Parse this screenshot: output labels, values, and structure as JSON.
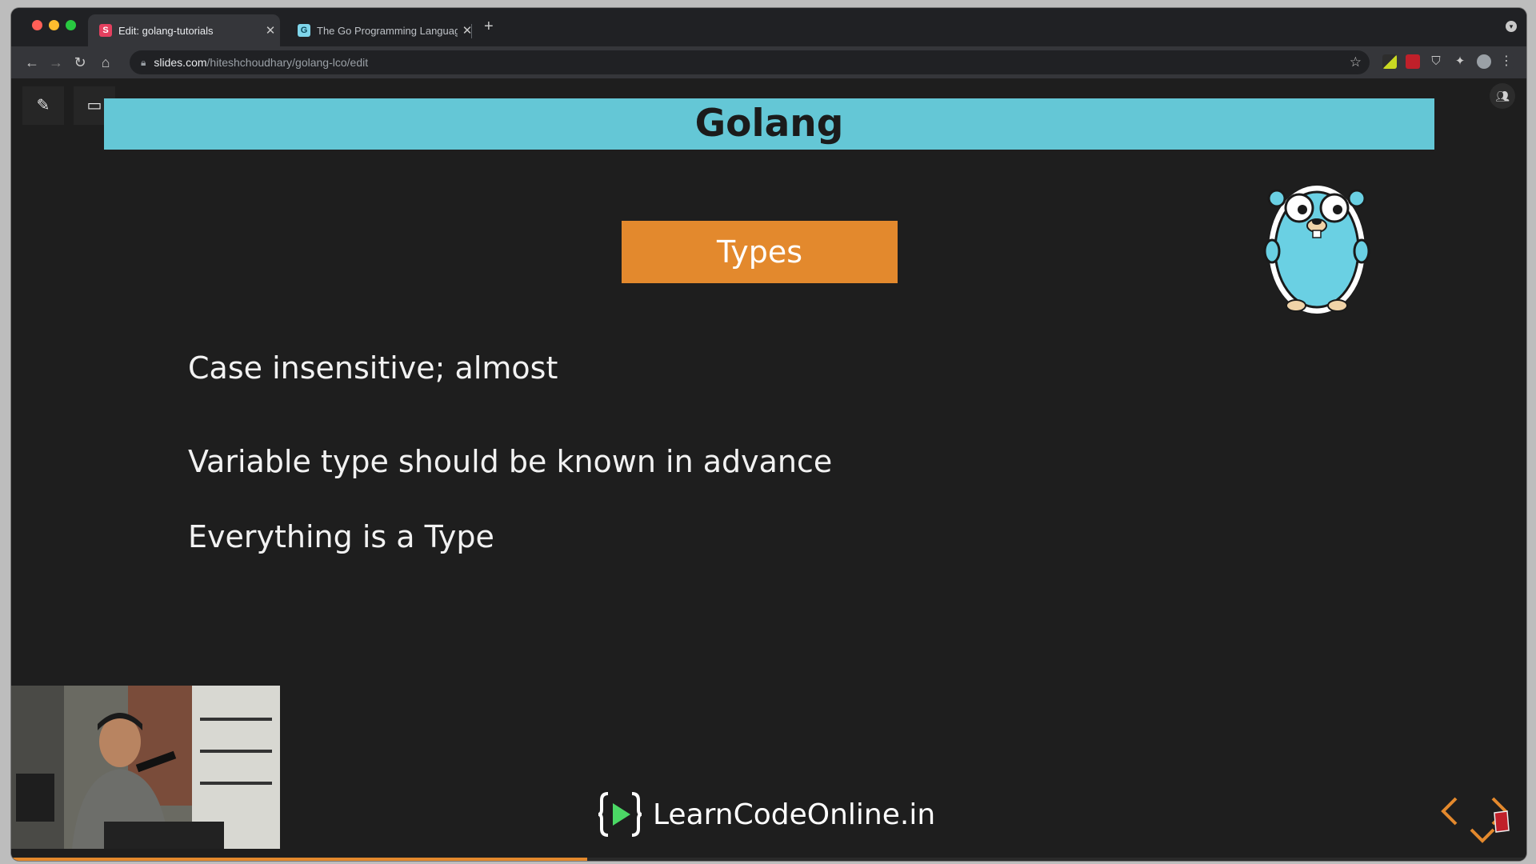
{
  "browser": {
    "tabs": [
      {
        "title": "Edit: golang-tutorials",
        "favicon_icon": "slides-icon",
        "active": true
      },
      {
        "title": "The Go Programming Languag",
        "favicon_icon": "go-icon",
        "active": false
      }
    ],
    "new_tab_label": "+",
    "url_host": "slides.com",
    "url_path": "/hiteshchoudhary/golang-lco/edit"
  },
  "editor": {
    "tools": [
      "pen-icon",
      "present-icon"
    ],
    "collaborators_icon": "people-icon"
  },
  "slide": {
    "title": "Golang",
    "section": "Types",
    "bullets": [
      "Case insensitive; almost",
      "Variable type should be known in advance",
      "Everything is a Type"
    ],
    "logo_text": "LearnCodeOnline.in",
    "progress_fraction": 0.38
  },
  "colors": {
    "title_bar": "#64c7d6",
    "section_box": "#e3892d",
    "slide_background": "#1e1e1e",
    "gopher": "#6ad0e3",
    "logo_green": "#4bd865"
  }
}
